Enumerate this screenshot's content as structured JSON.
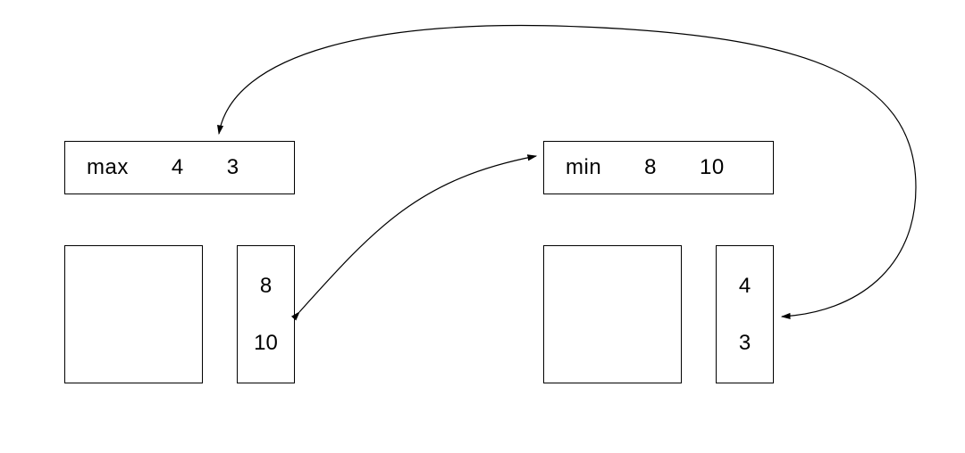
{
  "frames": {
    "left": {
      "call": {
        "op": "max",
        "args": [
          "4",
          "3"
        ]
      },
      "stack": {
        "items": [
          "8",
          "10"
        ]
      }
    },
    "right": {
      "call": {
        "op": "min",
        "args": [
          "8",
          "10"
        ]
      },
      "stack": {
        "items": [
          "4",
          "3"
        ]
      }
    }
  }
}
